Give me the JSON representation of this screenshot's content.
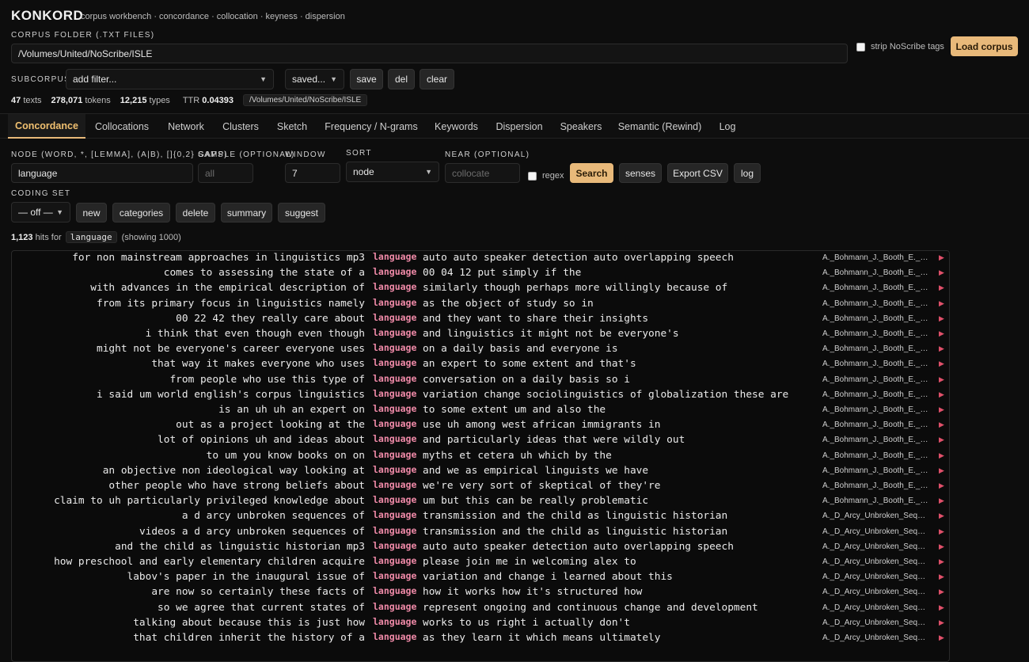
{
  "app": {
    "name": "KONKORD",
    "tagline": "corpus workbench · concordance · collocation · keyness · dispersion"
  },
  "corpus": {
    "folder_label": "CORPUS FOLDER (.TXT FILES)",
    "folder_value": "/Volumes/United/NoScribe/ISLE",
    "strip_label": "strip NoScribe tags",
    "load_label": "Load corpus"
  },
  "subcorpus": {
    "label": "SUBCORPUS",
    "filter_value": "add filter...",
    "saved_value": "saved...",
    "save_label": "save",
    "del_label": "del",
    "clear_label": "clear"
  },
  "stats": {
    "texts_value": "47",
    "texts_label": "texts",
    "tokens_value": "278,071",
    "tokens_label": "tokens",
    "types_value": "12,215",
    "types_label": "types",
    "ttr_label": "TTR",
    "ttr_value": "0.04393",
    "path": "/Volumes/United/NoScribe/ISLE"
  },
  "tabs": [
    {
      "label": "Concordance",
      "active": true
    },
    {
      "label": "Collocations"
    },
    {
      "label": "Network"
    },
    {
      "label": "Clusters"
    },
    {
      "label": "Sketch"
    },
    {
      "label": "Frequency / N-grams"
    },
    {
      "label": "Keywords"
    },
    {
      "label": "Dispersion"
    },
    {
      "label": "Speakers"
    },
    {
      "label": "Semantic (Rewind)"
    },
    {
      "label": "Log"
    }
  ],
  "search": {
    "node_label": "NODE (WORD, *, [LEMMA], (A|B), []{0,2} GAPS)",
    "node_value": "language",
    "sample_label": "SAMPLE (OPTIONAL)",
    "sample_placeholder": "all",
    "window_label": "WINDOW",
    "window_value": "7",
    "sort_label": "SORT",
    "sort_value": "node",
    "near_label": "NEAR (OPTIONAL)",
    "near_placeholder": "collocate",
    "regex_label": "regex",
    "search_label": "Search",
    "senses_label": "senses",
    "export_label": "Export CSV",
    "log_label": "log"
  },
  "coding": {
    "label": "CODING SET",
    "select_value": "— off —",
    "new_label": "new",
    "categories_label": "categories",
    "delete_label": "delete",
    "summary_label": "summary",
    "suggest_label": "suggest"
  },
  "hits": {
    "count": "1,123",
    "mid": "hits for",
    "keyword": "language",
    "showing": "(showing 1000)"
  },
  "icons": {
    "play": "play-triangle-icon",
    "chevron": "chevron-down-icon"
  },
  "colors": {
    "accent": "#e8b97a",
    "keyword": "#f08aa8",
    "play": "#e0506a"
  },
  "concordance": [
    {
      "left": "for non mainstream approaches in linguistics mp3",
      "kw": "language",
      "right": "auto auto speaker detection auto overlapping speech",
      "src": "A._Bohmann_J._Booth_E._Bohmann"
    },
    {
      "left": "comes to assessing the state of a",
      "kw": "language",
      "right": "00 04 12 put simply if the",
      "src": "A._Bohmann_J._Booth_E._Bohmann"
    },
    {
      "left": "with advances in the empirical description of",
      "kw": "language",
      "right": "similarly though perhaps more willingly because of",
      "src": "A._Bohmann_J._Booth_E._Bohmann"
    },
    {
      "left": "from its primary focus in linguistics namely",
      "kw": "language",
      "right": "as the object of study so in",
      "src": "A._Bohmann_J._Booth_E._Bohmann"
    },
    {
      "left": "00 22 42 they really care about",
      "kw": "language",
      "right": "and they want to share their insights",
      "src": "A._Bohmann_J._Booth_E._Bohmann"
    },
    {
      "left": "i think that even though even though",
      "kw": "language",
      "right": "and linguistics it might not be everyone's",
      "src": "A._Bohmann_J._Booth_E._Bohmann"
    },
    {
      "left": "might not be everyone's career everyone uses",
      "kw": "language",
      "right": "on a daily basis and everyone is",
      "src": "A._Bohmann_J._Booth_E._Bohmann"
    },
    {
      "left": "that way it makes everyone who uses",
      "kw": "language",
      "right": "an expert to some extent and that's",
      "src": "A._Bohmann_J._Booth_E._Bohmann"
    },
    {
      "left": "from people who use this type of",
      "kw": "language",
      "right": "conversation on a daily basis so i",
      "src": "A._Bohmann_J._Booth_E._Bohmann"
    },
    {
      "left": "i said um world english's corpus linguistics",
      "kw": "language",
      "right": "variation change sociolinguistics of globalization these are",
      "src": "A._Bohmann_J._Booth_E._Bohmann"
    },
    {
      "left": "is an uh uh an expert on",
      "kw": "language",
      "right": "to some extent um and also the",
      "src": "A._Bohmann_J._Booth_E._Bohmann"
    },
    {
      "left": "out as a project looking at the",
      "kw": "language",
      "right": "use uh among west african immigrants in",
      "src": "A._Bohmann_J._Booth_E._Bohmann"
    },
    {
      "left": "lot of opinions uh and ideas about",
      "kw": "language",
      "right": "and particularly ideas that were wildly out",
      "src": "A._Bohmann_J._Booth_E._Bohmann"
    },
    {
      "left": "to um you know books on on",
      "kw": "language",
      "right": "myths et cetera uh which by the",
      "src": "A._Bohmann_J._Booth_E._Bohmann"
    },
    {
      "left": "an objective non ideological way looking at",
      "kw": "language",
      "right": "and we as empirical linguists we have",
      "src": "A._Bohmann_J._Booth_E._Bohmann"
    },
    {
      "left": "other people who have strong beliefs about",
      "kw": "language",
      "right": "we're very sort of skeptical of they're",
      "src": "A._Bohmann_J._Booth_E._Bohmann"
    },
    {
      "left": "claim to uh particularly privileged knowledge about",
      "kw": "language",
      "right": "um but this can be really problematic",
      "src": "A._Bohmann_J._Booth_E._Bohmann"
    },
    {
      "left": "a d arcy unbroken sequences of",
      "kw": "language",
      "right": "transmission and the child as linguistic historian",
      "src": "A._D_Arcy_Unbroken_Sequences"
    },
    {
      "left": "videos a d arcy unbroken sequences of",
      "kw": "language",
      "right": "transmission and the child as linguistic historian",
      "src": "A._D_Arcy_Unbroken_Sequences"
    },
    {
      "left": "and the child as linguistic historian mp3",
      "kw": "language",
      "right": "auto auto speaker detection auto overlapping speech",
      "src": "A._D_Arcy_Unbroken_Sequences"
    },
    {
      "left": "how preschool and early elementary children acquire",
      "kw": "language",
      "right": "please join me in welcoming alex to",
      "src": "A._D_Arcy_Unbroken_Sequences"
    },
    {
      "left": "labov's paper in the inaugural issue of",
      "kw": "language",
      "right": "variation and change i learned about this",
      "src": "A._D_Arcy_Unbroken_Sequences"
    },
    {
      "left": "are now so certainly these facts of",
      "kw": "language",
      "right": "how it works how it's structured how",
      "src": "A._D_Arcy_Unbroken_Sequences"
    },
    {
      "left": "so we agree that current states of",
      "kw": "language",
      "right": "represent ongoing and continuous change and development",
      "src": "A._D_Arcy_Unbroken_Sequences"
    },
    {
      "left": "talking about because this is just how",
      "kw": "language",
      "right": "works to us right i actually don't",
      "src": "A._D_Arcy_Unbroken_Sequences"
    },
    {
      "left": "that children inherit the history of a",
      "kw": "language",
      "right": "as they learn it which means ultimately",
      "src": "A._D_Arcy_Unbroken_Sequences"
    }
  ]
}
